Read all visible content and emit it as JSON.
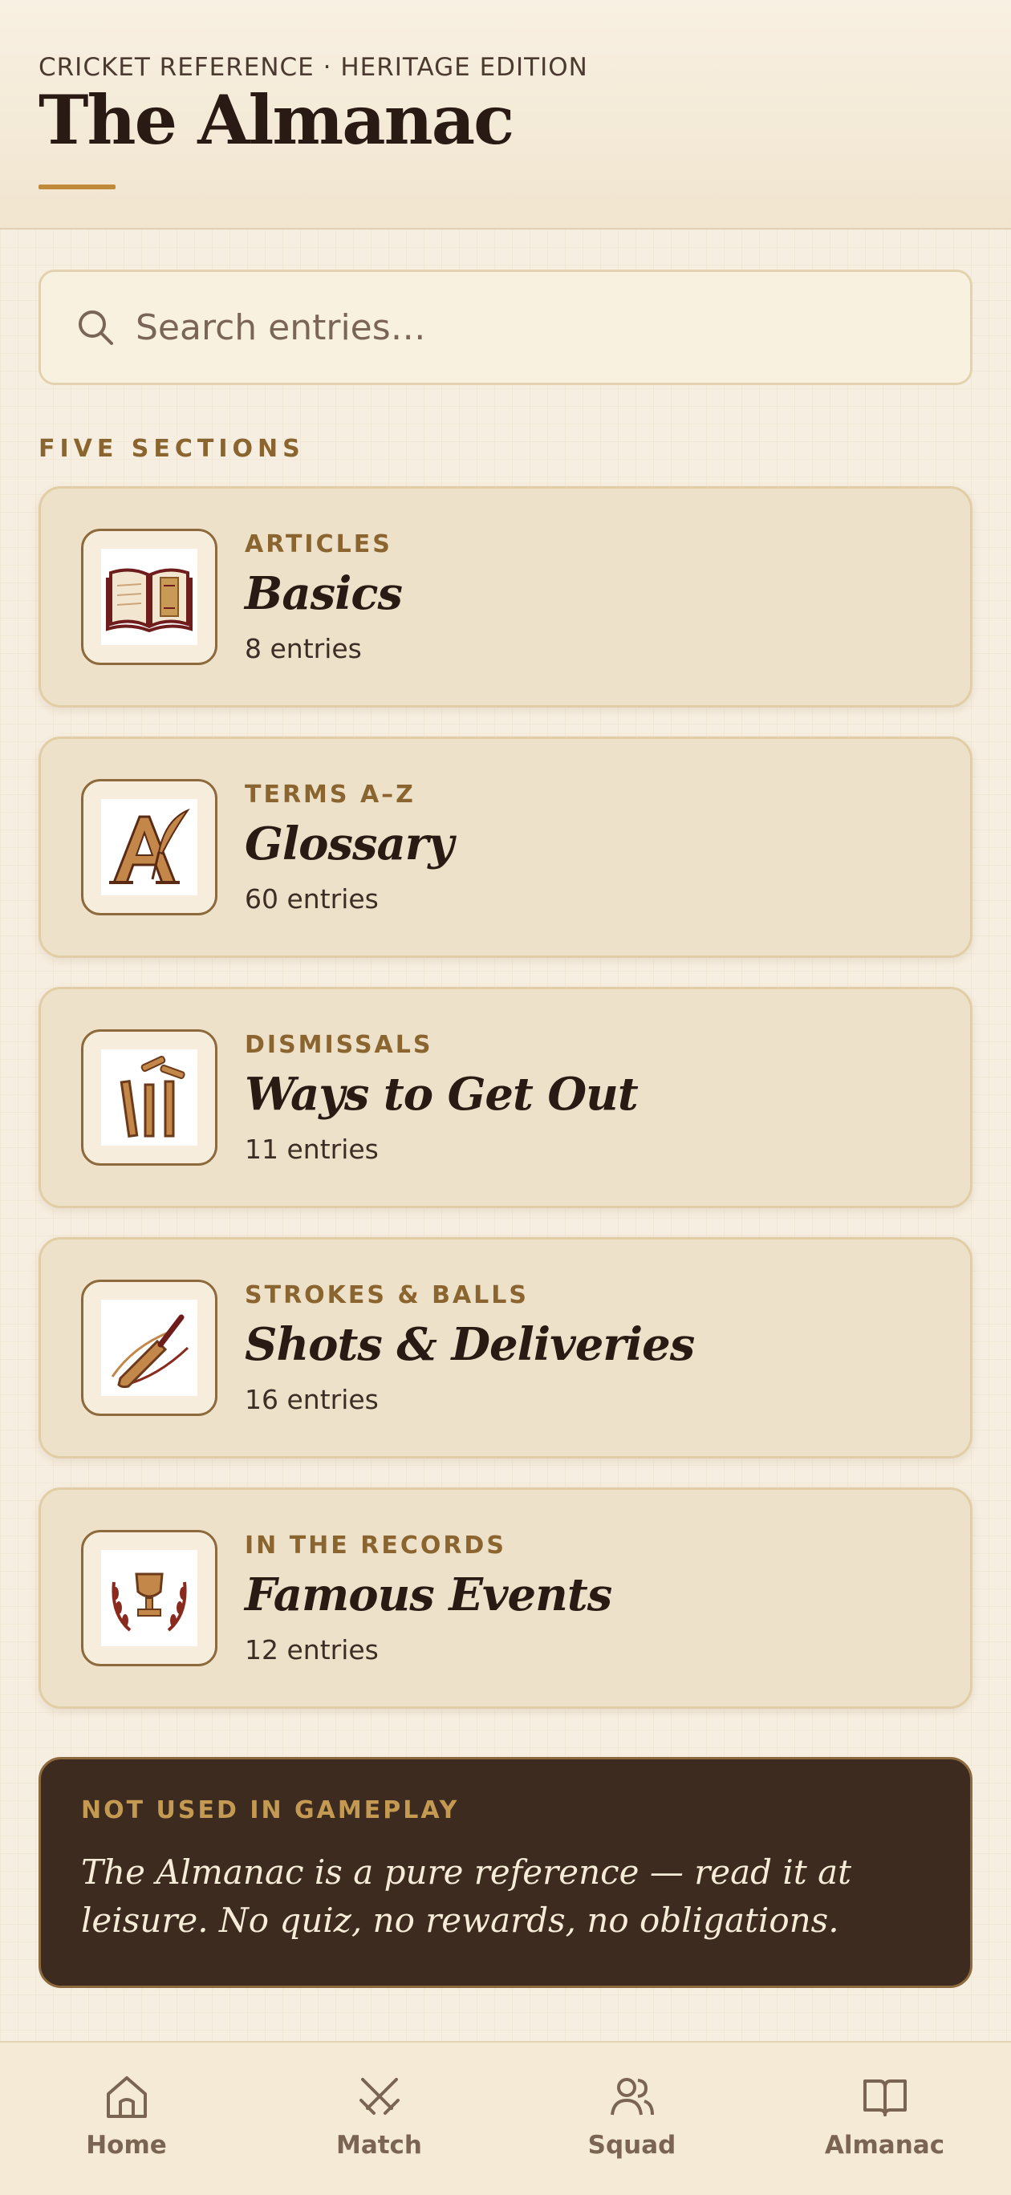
{
  "header": {
    "eyebrow": "CRICKET REFERENCE · HERITAGE EDITION",
    "title": "The Almanac"
  },
  "search": {
    "placeholder": "Search entries…"
  },
  "sections_label": "FIVE SECTIONS",
  "sections": [
    {
      "kicker": "ARTICLES",
      "name": "Basics",
      "count": "8 entries",
      "icon": "open-book-icon"
    },
    {
      "kicker": "TERMS A–Z",
      "name": "Glossary",
      "count": "60 entries",
      "icon": "quill-letter-a-icon"
    },
    {
      "kicker": "DISMISSALS",
      "name": "Ways to Get Out",
      "count": "11 entries",
      "icon": "broken-wicket-icon"
    },
    {
      "kicker": "STROKES & BALLS",
      "name": "Shots & Deliveries",
      "count": "16 entries",
      "icon": "cricket-bat-icon"
    },
    {
      "kicker": "IN THE RECORDS",
      "name": "Famous Events",
      "count": "12 entries",
      "icon": "trophy-laurel-icon"
    }
  ],
  "note": {
    "kicker": "NOT USED IN GAMEPLAY",
    "body": "The Almanac is a pure reference — read it at leisure. No quiz, no rewards, no obligations."
  },
  "tabs": [
    {
      "label": "Home",
      "icon": "home-icon"
    },
    {
      "label": "Match",
      "icon": "crossed-swords-icon"
    },
    {
      "label": "Squad",
      "icon": "users-icon"
    },
    {
      "label": "Almanac",
      "icon": "book-icon"
    }
  ],
  "colors": {
    "background": "#f6eee0",
    "card": "#ede1c9",
    "accent": "#8b6530",
    "dark_panel": "#3d2b20",
    "ink": "#2a1a14"
  }
}
